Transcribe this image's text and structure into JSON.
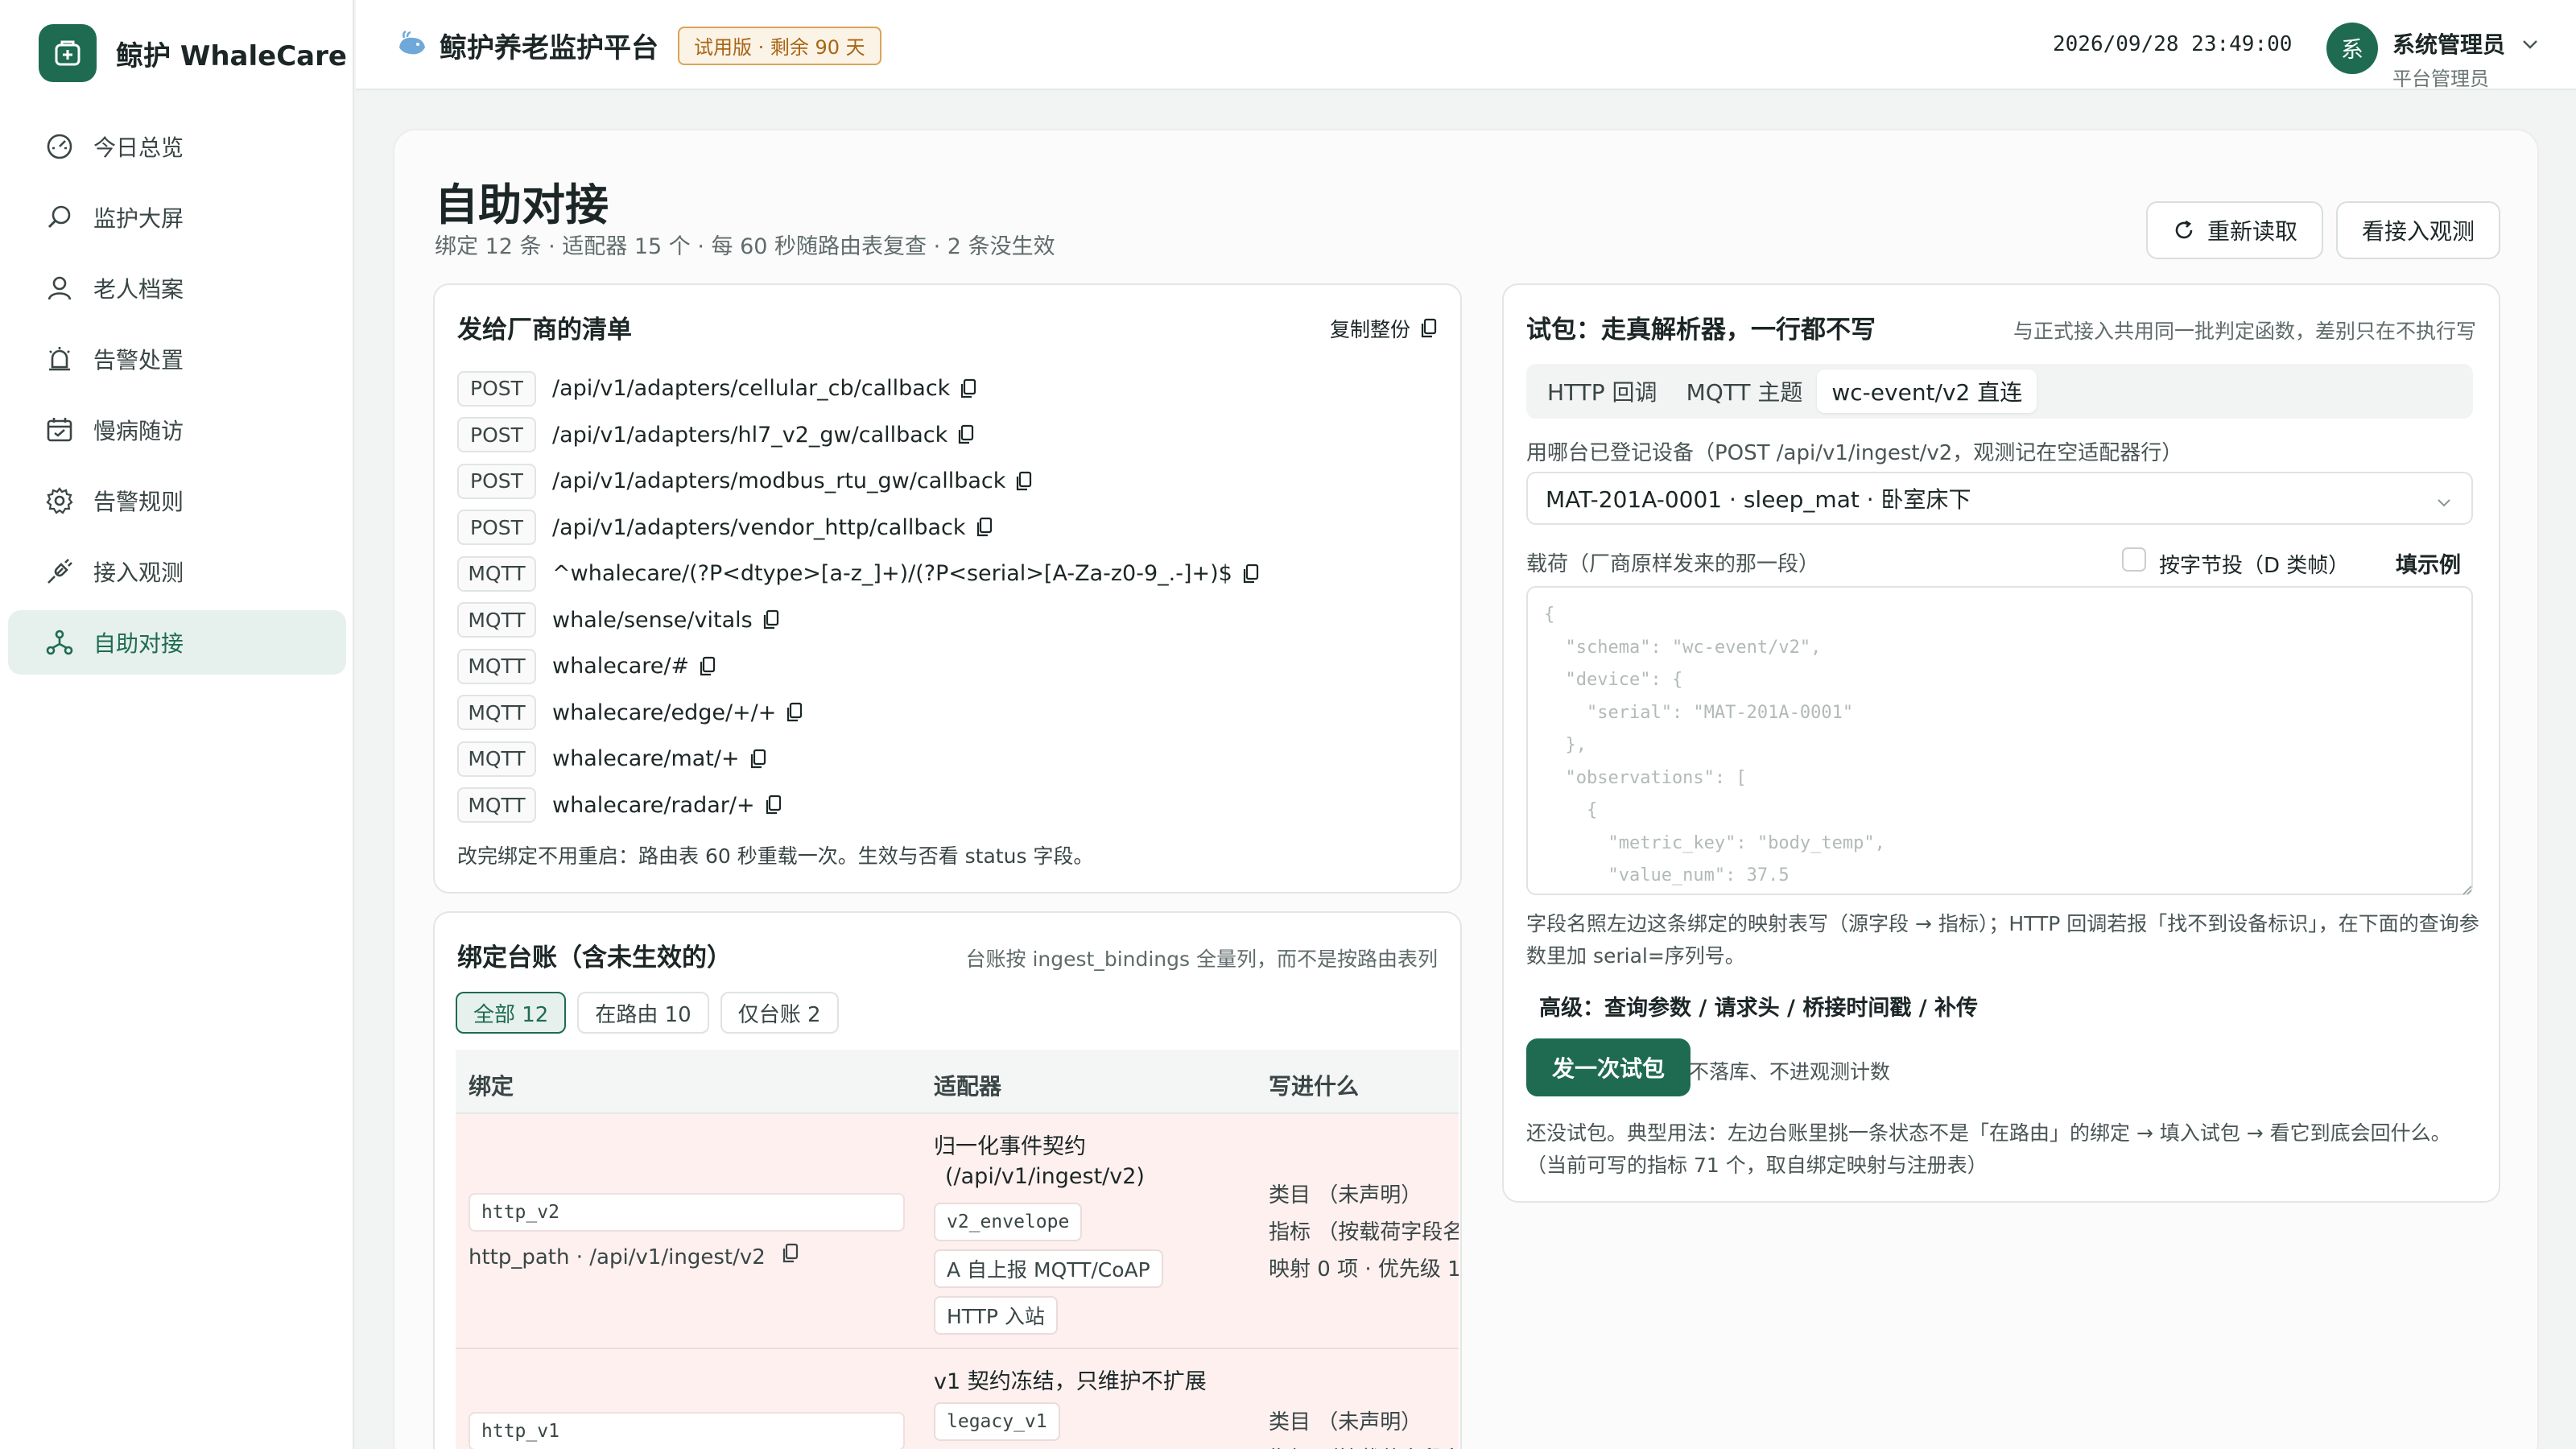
{
  "brand": {
    "name": "鲸护 WhaleCare"
  },
  "sidebar": {
    "items": [
      {
        "label": "今日总览",
        "icon": "dashboard-gauge-icon"
      },
      {
        "label": "监护大屏",
        "icon": "monitor-search-icon"
      },
      {
        "label": "老人档案",
        "icon": "user-profile-icon"
      },
      {
        "label": "告警处置",
        "icon": "alarm-bell-icon"
      },
      {
        "label": "慢病随访",
        "icon": "calendar-check-icon"
      },
      {
        "label": "告警规则",
        "icon": "gear-icon"
      },
      {
        "label": "接入观测",
        "icon": "plug-icon"
      },
      {
        "label": "自助对接",
        "icon": "network-nodes-icon"
      }
    ],
    "active_index": 7
  },
  "header": {
    "title": "鲸护养老监护平台",
    "badge": "试用版 · 剩余 90 天",
    "datetime": "2026/09/28 23:49:00",
    "avatar_char": "系",
    "user_name": "系统管理员",
    "user_role": "平台管理员"
  },
  "page": {
    "title": "自助对接",
    "subtitle": "绑定 12 条 · 适配器 15 个 · 每 60 秒随路由表复查 · 2 条没生效",
    "reload_button": "重新读取",
    "observe_button": "看接入观测"
  },
  "manifest": {
    "title": "发给厂商的清单",
    "copy_all": "复制整份",
    "rows": [
      {
        "method": "POST",
        "path": "/api/v1/adapters/cellular_cb/callback"
      },
      {
        "method": "POST",
        "path": "/api/v1/adapters/hl7_v2_gw/callback"
      },
      {
        "method": "POST",
        "path": "/api/v1/adapters/modbus_rtu_gw/callback"
      },
      {
        "method": "POST",
        "path": "/api/v1/adapters/vendor_http/callback"
      },
      {
        "method": "MQTT",
        "path": "^whalecare/(?P<dtype>[a-z_]+)/(?P<serial>[A-Za-z0-9_.-]+)$"
      },
      {
        "method": "MQTT",
        "path": "whale/sense/vitals"
      },
      {
        "method": "MQTT",
        "path": "whalecare/#"
      },
      {
        "method": "MQTT",
        "path": "whalecare/edge/+/+"
      },
      {
        "method": "MQTT",
        "path": "whalecare/mat/+"
      },
      {
        "method": "MQTT",
        "path": "whalecare/radar/+"
      }
    ],
    "footer": "改完绑定不用重启：路由表 60 秒重载一次。生效与否看 status 字段。"
  },
  "ledger": {
    "title": "绑定台账（含未生效的）",
    "note": "台账按 ingest_bindings 全量列，而不是按路由表列",
    "filters": [
      "全部 12",
      "在路由 10",
      "仅台账 2"
    ],
    "active_filter": 0,
    "columns": [
      "绑定",
      "适配器",
      "写进什么"
    ],
    "rows": [
      {
        "binding_code": "http_v2",
        "binding_path": "http_path · /api/v1/ingest/v2",
        "adapter_title_1": "归一化事件契约",
        "adapter_title_2": "(/api/v1/ingest/v2)",
        "adapter_tags": [
          "v2_envelope",
          "A 自上报 MQTT/CoAP",
          "HTTP 入站"
        ],
        "writes": [
          "类目 （未声明）",
          "指标 （按载荷字段名",
          "映射 0 项 · 优先级 1"
        ]
      },
      {
        "binding_code": "http_v1",
        "adapter_title_1": "v1 契约冻结，只维护不扩展",
        "adapter_tags": [
          "legacy_v1"
        ],
        "writes": [
          "类目 （未声明）",
          "指标 （按载荷字段名"
        ]
      }
    ]
  },
  "tester": {
    "title": "试包：走真解析器，一行都不写",
    "note": "与正式接入共用同一批判定函数，差别只在不执行写",
    "tabs": [
      "HTTP 回调",
      "MQTT 主题",
      "wc-event/v2 直连"
    ],
    "active_tab": 2,
    "device_label": "用哪台已登记设备（POST /api/v1/ingest/v2，观测记在空适配器行）",
    "device_value": "MAT-201A-0001 · sleep_mat · 卧室床下",
    "payload_label": "载荷（厂商原样发来的那一段）",
    "byte_checkbox_label": "按字节投（D 类帧）",
    "fill_example": "填示例",
    "payload_placeholder": "{\n  \"schema\": \"wc-event/v2\",\n  \"device\": {\n    \"serial\": \"MAT-201A-0001\"\n  },\n  \"observations\": [\n    {\n      \"metric_key\": \"body_temp\",\n      \"value_num\": 37.5",
    "hint": "字段名照左边这条绑定的映射表写（源字段 → 指标）；HTTP 回调若报「找不到设备标识」，在下面的查询参数里加 serial=序列号。",
    "advanced": "高级：查询参数 / 请求头 / 桥接时间戳 / 补传",
    "send_button": "发一次试包",
    "send_note": "不落库、不进观测计数",
    "result": "还没试包。典型用法：左边台账里挑一条状态不是「在路由」的绑定 → 填入试包 → 看它到底会回什么。（当前可写的指标 71 个，取自绑定映射与注册表）"
  },
  "colors": {
    "accent": "#1e6b52",
    "trial_badge": "#a86514",
    "warn_row": "#fdf0ef"
  }
}
